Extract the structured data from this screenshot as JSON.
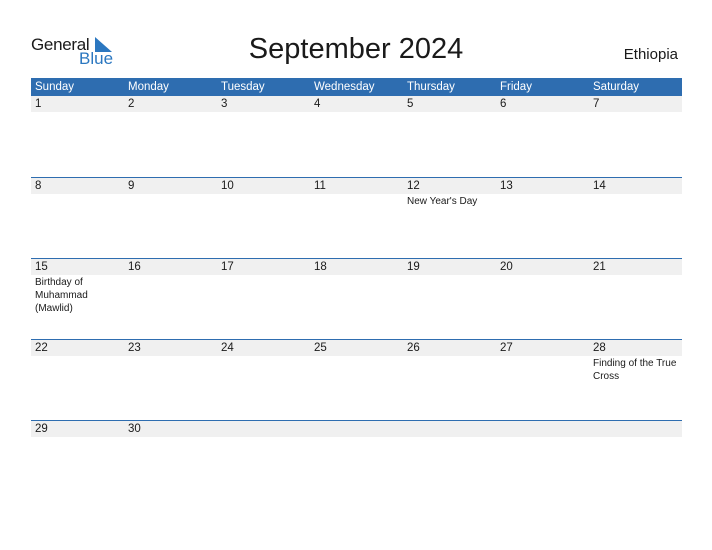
{
  "logo": {
    "word1": "General",
    "word2": "Blue",
    "brand_color": "#2b77c0"
  },
  "title": "September 2024",
  "country": "Ethiopia",
  "colors": {
    "header_bg": "#2e6db0",
    "date_row_bg": "#f0f0f0"
  },
  "weekdays": [
    "Sunday",
    "Monday",
    "Tuesday",
    "Wednesday",
    "Thursday",
    "Friday",
    "Saturday"
  ],
  "weeks": [
    {
      "days": [
        {
          "date": "1",
          "events": []
        },
        {
          "date": "2",
          "events": []
        },
        {
          "date": "3",
          "events": []
        },
        {
          "date": "4",
          "events": []
        },
        {
          "date": "5",
          "events": []
        },
        {
          "date": "6",
          "events": []
        },
        {
          "date": "7",
          "events": []
        }
      ]
    },
    {
      "days": [
        {
          "date": "8",
          "events": []
        },
        {
          "date": "9",
          "events": []
        },
        {
          "date": "10",
          "events": []
        },
        {
          "date": "11",
          "events": []
        },
        {
          "date": "12",
          "events": [
            "New Year's Day"
          ]
        },
        {
          "date": "13",
          "events": []
        },
        {
          "date": "14",
          "events": []
        }
      ]
    },
    {
      "days": [
        {
          "date": "15",
          "events": [
            "Birthday of Muhammad (Mawlid)"
          ]
        },
        {
          "date": "16",
          "events": []
        },
        {
          "date": "17",
          "events": []
        },
        {
          "date": "18",
          "events": []
        },
        {
          "date": "19",
          "events": []
        },
        {
          "date": "20",
          "events": []
        },
        {
          "date": "21",
          "events": []
        }
      ]
    },
    {
      "days": [
        {
          "date": "22",
          "events": []
        },
        {
          "date": "23",
          "events": []
        },
        {
          "date": "24",
          "events": []
        },
        {
          "date": "25",
          "events": []
        },
        {
          "date": "26",
          "events": []
        },
        {
          "date": "27",
          "events": []
        },
        {
          "date": "28",
          "events": [
            "Finding of the True Cross"
          ]
        }
      ]
    },
    {
      "days": [
        {
          "date": "29",
          "events": []
        },
        {
          "date": "30",
          "events": []
        },
        {
          "date": "",
          "events": []
        },
        {
          "date": "",
          "events": []
        },
        {
          "date": "",
          "events": []
        },
        {
          "date": "",
          "events": []
        },
        {
          "date": "",
          "events": []
        }
      ]
    }
  ]
}
